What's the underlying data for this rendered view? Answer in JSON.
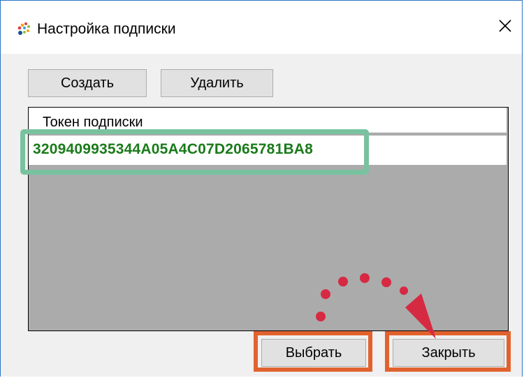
{
  "window": {
    "title": "Настройка подписки"
  },
  "toolbar": {
    "create_label": "Создать",
    "delete_label": "Удалить"
  },
  "table": {
    "header": "Токен подписки",
    "rows": [
      {
        "token": "3209409935344A05A4C07D2065781BA8"
      }
    ]
  },
  "footer": {
    "select_label": "Выбрать",
    "close_label": "Закрыть"
  },
  "annotations": {
    "token_highlight_color": "#79c2a0",
    "button_highlight_color": "#e2622f",
    "arrow_color": "#d62a43"
  }
}
